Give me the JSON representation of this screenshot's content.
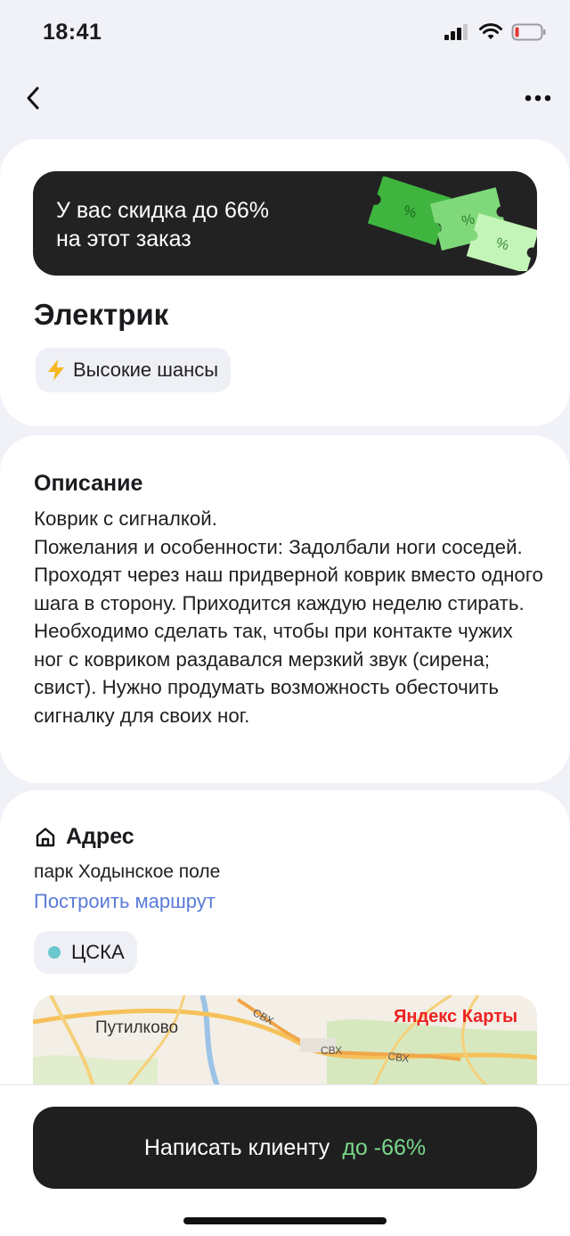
{
  "status": {
    "time": "18:41"
  },
  "promo": {
    "text": "У вас скидка до 66%\nна этот заказ",
    "coupon_symbol": "%"
  },
  "order": {
    "title": "Электрик",
    "chip_label": "Высокие шансы"
  },
  "description": {
    "heading": "Описание",
    "text": "Коврик с сигналкой.\nПожелания и особенности: Задолбали ноги соседей. Проходят через наш придверной коврик вместо одного шага в сторону. Приходится каждую неделю стирать.\nНеобходимо сделать так, чтобы при контакте чужих ног с ковриком раздавался мерзкий звук (сирена; свист). Нужно продумать возможность обесточить сигналку для своих ног."
  },
  "address": {
    "heading": "Адрес",
    "text": "парк Ходынское поле",
    "route_link": "Построить маршрут",
    "metro": "ЦСКА",
    "metro_color": "#6bc8cf"
  },
  "map": {
    "brand": "Яндекс Карты",
    "labels": {
      "town": "Путилково",
      "road1": "СВХ",
      "road2": "СВХ",
      "road3": "СВХ"
    }
  },
  "cta": {
    "label": "Написать клиенту",
    "discount": "до -66%"
  },
  "colors": {
    "accent_green": "#79d98a",
    "link_blue": "#5a7bd8",
    "lightning": "#f5b81f"
  }
}
